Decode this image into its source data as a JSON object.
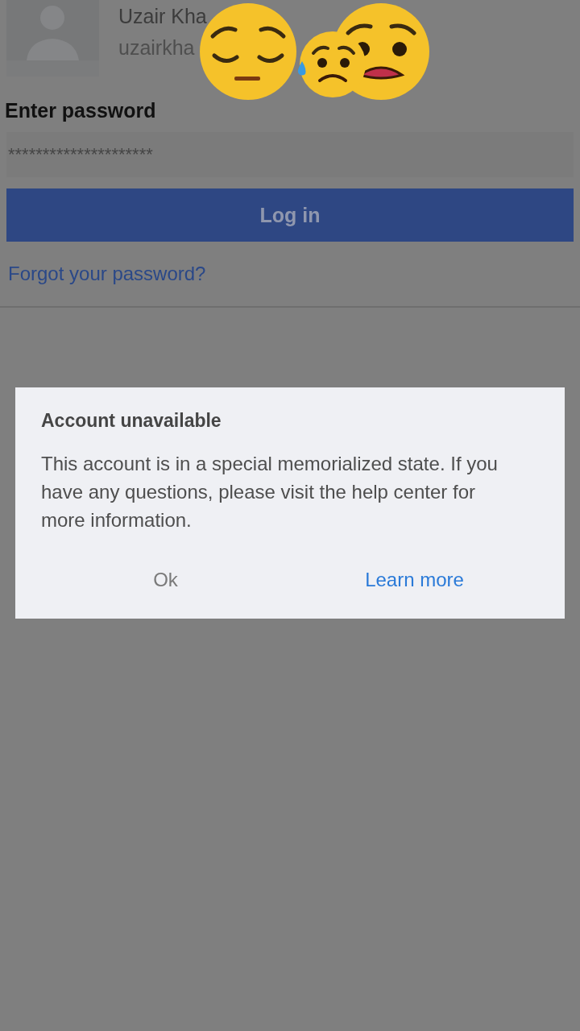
{
  "profile": {
    "name": "Uzair Kha",
    "username": "uzairkha"
  },
  "password": {
    "label": "Enter password",
    "value": "*********************"
  },
  "login_button": {
    "label": "Log in",
    "disabled": true
  },
  "forgot_link": "Forgot your password?",
  "dialog": {
    "title": "Account unavailable",
    "message": "This account is in a special memorialized state. If you have any questions, please visit the help center for more information.",
    "buttons": [
      {
        "label": "Ok",
        "kind": "neutral"
      },
      {
        "label": "Learn more",
        "kind": "primary"
      }
    ]
  }
}
